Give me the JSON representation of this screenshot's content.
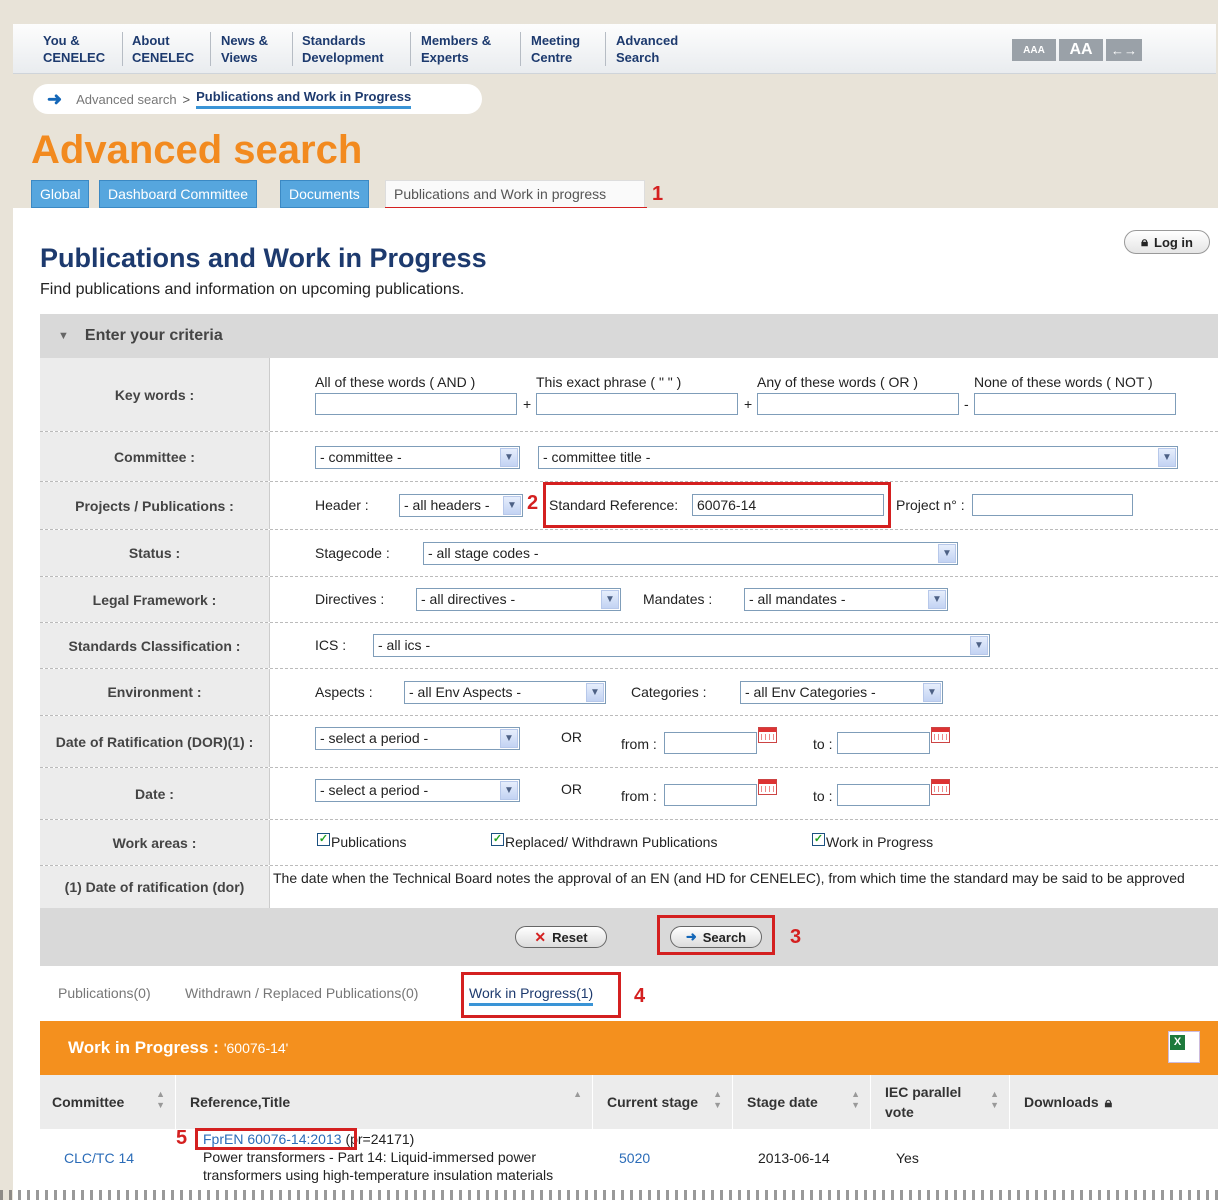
{
  "nav": [
    "You &\nCENELEC",
    "About\nCENELEC",
    "News &\nViews",
    "Standards\nDevelopment",
    "Members &\nExperts",
    "Meeting\nCentre",
    "Advanced\nSearch"
  ],
  "font_tools": [
    "AAA",
    "AA",
    "←→"
  ],
  "breadcrumb": {
    "parent": "Advanced search",
    "separator": ">",
    "current": "Publications and Work in Progress"
  },
  "heading": "Advanced search",
  "tabs": [
    "Global",
    "Dashboard Committee",
    "Documents",
    "Publications and Work in progress"
  ],
  "login_label": "Log in",
  "section": {
    "title": "Publications and Work in Progress",
    "subtitle": "Find publications and information on upcoming publications."
  },
  "criteria_header": "Enter your criteria",
  "criteria": {
    "keywords": {
      "label": "Key words :",
      "and_label": "All of these words ( AND )",
      "phrase_label": "This exact phrase ( \" \" )",
      "or_label": "Any of these words ( OR )",
      "not_label": "None of these words ( NOT )",
      "plus": "+",
      "minus": "-"
    },
    "committee": {
      "label": "Committee :",
      "committee_value": "- committee -",
      "title_value": "- committee title -"
    },
    "projects": {
      "label": "Projects / Publications :",
      "header_label": "Header :",
      "header_value": "- all headers -",
      "stdref_label": "Standard Reference:",
      "stdref_value": "60076-14",
      "project_label": "Project n° :"
    },
    "status": {
      "label": "Status :",
      "stagecode_label": "Stagecode :",
      "stagecode_value": "- all stage codes -"
    },
    "legal": {
      "label": "Legal Framework :",
      "directives_label": "Directives :",
      "directives_value": "- all directives -",
      "mandates_label": "Mandates :",
      "mandates_value": "- all mandates -"
    },
    "classification": {
      "label": "Standards Classification :",
      "ics_label": "ICS :",
      "ics_value": "- all ics -"
    },
    "environment": {
      "label": "Environment :",
      "aspects_label": "Aspects :",
      "aspects_value": "- all Env Aspects -",
      "categories_label": "Categories :",
      "categories_value": "- all Env Categories -"
    },
    "dor": {
      "label": "Date of Ratification (DOR)(1) :",
      "period_value": "- select a period -",
      "or": "OR",
      "from": "from :",
      "to": "to :"
    },
    "date": {
      "label": "Date :",
      "period_value": "- select a period -",
      "or": "OR",
      "from": "from :",
      "to": "to :"
    },
    "work_areas": {
      "label": "Work areas :",
      "publications": "Publications",
      "replaced": "Replaced/ Withdrawn Publications",
      "wip": "Work in Progress"
    },
    "footnote": {
      "label": "(1) Date of ratification (dor)",
      "text": "The date when the Technical Board notes the approval of an EN (and HD for CENELEC), from which time the standard may be said to be approved"
    }
  },
  "buttons": {
    "reset": "Reset",
    "search": "Search"
  },
  "annotations": [
    "1",
    "2",
    "3",
    "4",
    "5"
  ],
  "result_tabs": [
    "Publications(0)",
    "Withdrawn / Replaced Publications(0)",
    "Work in Progress(1)"
  ],
  "results_bar": {
    "title": "Work in Progress :",
    "query": "'60076-14'"
  },
  "table": {
    "columns": [
      "Committee",
      "Reference,Title",
      "Current stage",
      "Stage date",
      "IEC parallel vote",
      "Downloads"
    ],
    "rows": [
      {
        "committee": "CLC/TC 14",
        "reference": "FprEN 60076-14:2013",
        "pr": "(pr=24171)",
        "title": "Power transformers - Part 14: Liquid-immersed power transformers using high-temperature insulation materials",
        "stage": "5020",
        "stage_date": "2013-06-14",
        "iec_vote": "Yes"
      }
    ]
  },
  "colors": {
    "orange": "#f28a1f",
    "navy": "#1d3a6e",
    "tab_blue": "#56a6de",
    "annotation_red": "#d42020"
  }
}
